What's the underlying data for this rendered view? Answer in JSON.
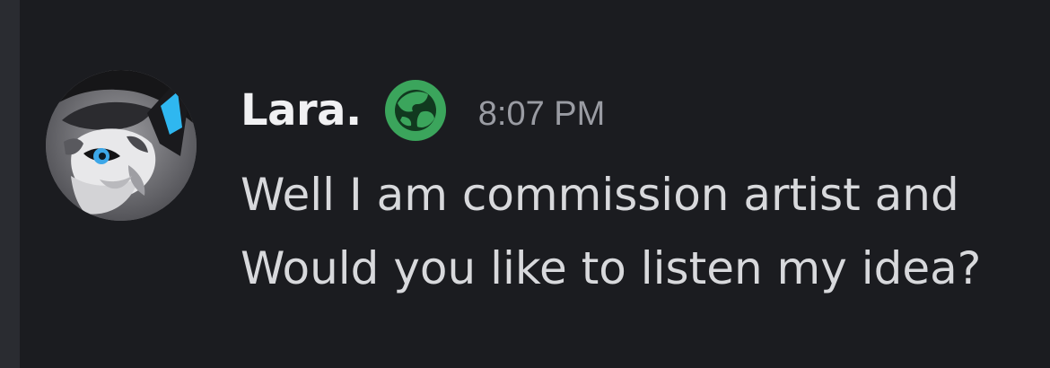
{
  "message": {
    "author": "Lara.",
    "badge_icon": "globe-icon",
    "badge_color": "#3ba55c",
    "timestamp": "8:07 PM",
    "lines": [
      "Well I am commission artist and",
      "Would you like to listen my idea?"
    ]
  },
  "avatar": {
    "icon": "wolf-avatar"
  },
  "colors": {
    "background": "#1b1c20",
    "username": "#f1f1f3",
    "timestamp": "#9a9ca3",
    "text": "#d8d9dc"
  }
}
